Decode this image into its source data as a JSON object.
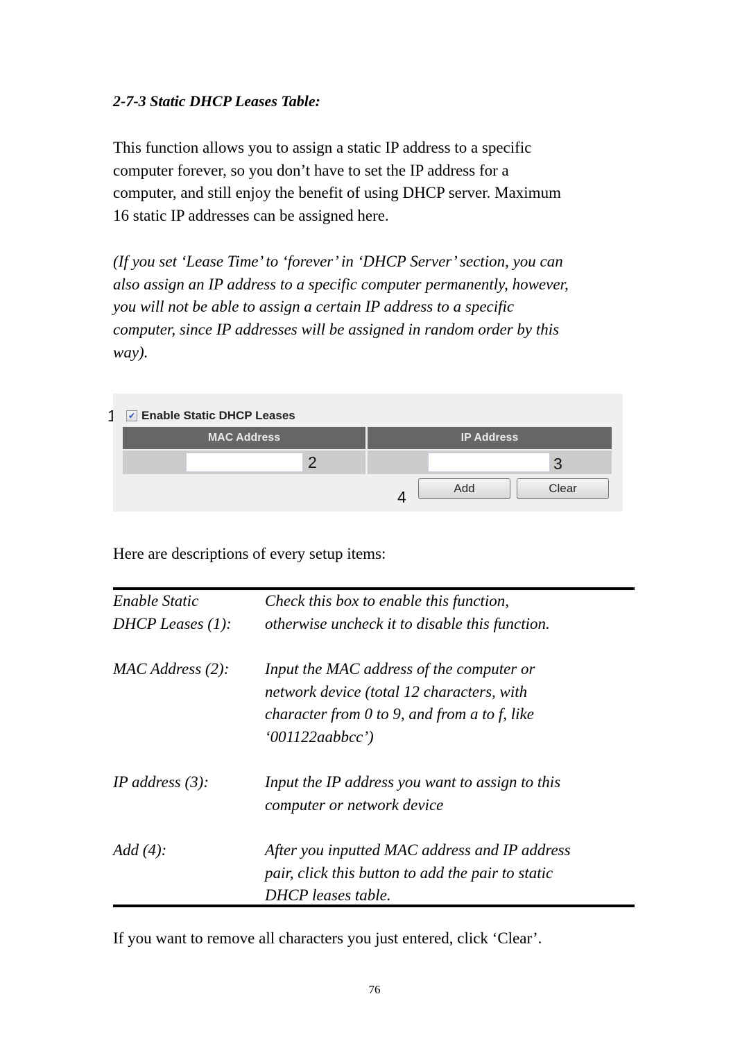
{
  "section_heading": "2-7-3 Static DHCP Leases Table:",
  "intro_paragraph": [
    "This function allows you to assign a static IP address to a specific",
    "computer forever, so you don’t have to set the IP address for a",
    "computer, and still enjoy the benefit of using DHCP server. Maximum",
    "16 static IP addresses can be assigned here."
  ],
  "note_paragraph": [
    "(If you set ‘Lease Time’ to ‘forever’ in ‘DHCP Server’ section, you can",
    "also assign an IP address to a specific computer permanently, however,",
    "you will not be able to assign a certain IP address to a specific",
    "computer, since IP addresses will be assigned in random order by this",
    "way)."
  ],
  "ui_screenshot": {
    "enable_checkbox": {
      "label": "Enable Static DHCP Leases",
      "checked": true,
      "check_glyph": "✔"
    },
    "columns": [
      "MAC Address",
      "IP Address"
    ],
    "mac_input": {
      "value": ""
    },
    "ip_input": {
      "value": ""
    },
    "buttons": {
      "add": "Add",
      "clear": "Clear"
    },
    "callouts": [
      "1",
      "2",
      "3",
      "4"
    ],
    "colors": {
      "panel_bg": "#efefef",
      "header_bg": "#666666",
      "header_text": "#eaeaea",
      "row_bg": "#cccccc",
      "checkbox_check": "#2a4bb3"
    }
  },
  "descriptions_intro": "Here are descriptions of every setup items:",
  "descriptions": [
    {
      "term": [
        "Enable Static",
        "DHCP Leases (1):"
      ],
      "definition": [
        "Check this box to enable this function,",
        "otherwise uncheck it to disable this function."
      ]
    },
    {
      "term": [
        "MAC Address (2):"
      ],
      "definition": [
        "Input the MAC address of the computer or",
        "network device (total 12 characters, with",
        "character from 0 to 9, and from a to f, like",
        "‘001122aabbcc’)"
      ]
    },
    {
      "term": [
        "IP address (3):"
      ],
      "definition": [
        "Input the IP address you want to assign to this",
        "computer or network device"
      ]
    },
    {
      "term": [
        "Add (4):"
      ],
      "definition": [
        "After you inputted MAC address and IP address",
        "pair, click this button to add the pair to static",
        "DHCP leases table."
      ]
    }
  ],
  "closing_text": "If you want to remove all characters you just entered, click ‘Clear’.",
  "page_number": "76"
}
